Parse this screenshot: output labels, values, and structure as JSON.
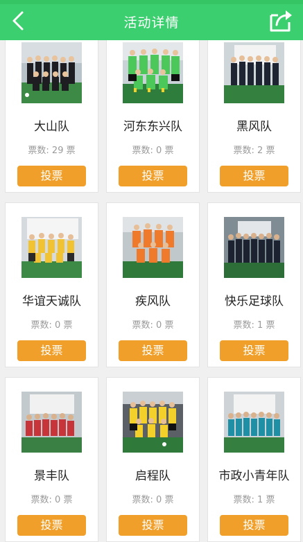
{
  "header": {
    "title": "活动详情",
    "color": "#3ccf6f"
  },
  "vote_button_color": "#f0a02a",
  "teams": [
    {
      "name": "大山队",
      "votes": "票数: 29 票",
      "button": "投票"
    },
    {
      "name": "河东东兴队",
      "votes": "票数: 0 票",
      "button": "投票"
    },
    {
      "name": "黑风队",
      "votes": "票数: 2 票",
      "button": "投票"
    },
    {
      "name": "华谊天诚队",
      "votes": "票数: 0 票",
      "button": "投票"
    },
    {
      "name": "疾风队",
      "votes": "票数: 0 票",
      "button": "投票"
    },
    {
      "name": "快乐足球队",
      "votes": "票数: 1 票",
      "button": "投票"
    },
    {
      "name": "景丰队",
      "votes": "票数: 0 票",
      "button": "投票"
    },
    {
      "name": "启程队",
      "votes": "票数: 0 票",
      "button": "投票"
    },
    {
      "name": "市政小青年队",
      "votes": "票数: 1 票",
      "button": "投票"
    }
  ]
}
